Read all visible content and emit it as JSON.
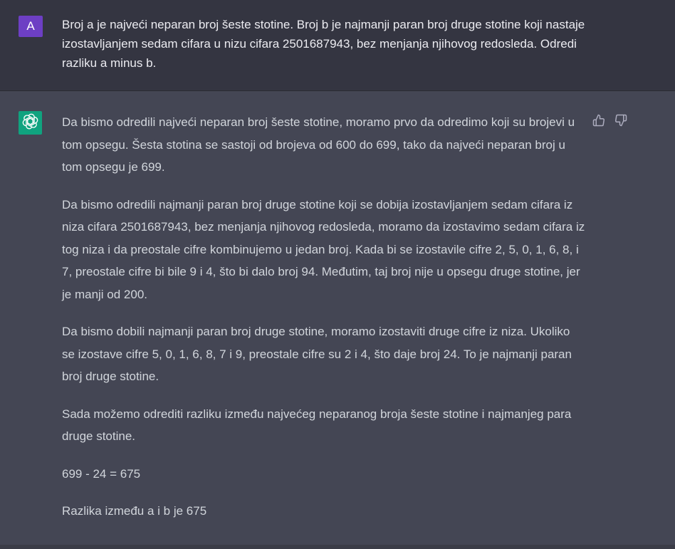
{
  "user": {
    "avatar_letter": "A",
    "avatar_color": "#6d3fc4",
    "message": "Broj a je najveći neparan broj šeste stotine. Broj b je najmanji paran broj druge stotine koji nastaje izostavljanjem sedam cifara u nizu cifara 2501687943, bez menjanja njihovog redosleda. Odredi razliku a minus b."
  },
  "assistant": {
    "avatar_icon": "openai-logo-icon",
    "avatar_color": "#10a37f",
    "feedback": {
      "like_icon": "thumbs-up-icon",
      "dislike_icon": "thumbs-down-icon"
    },
    "paragraphs": [
      "Da bismo odredili najveći neparan broj šeste stotine, moramo prvo da odredimo koji su brojevi u tom opsegu. Šesta stotina se sastoji od brojeva od 600 do 699, tako da najveći neparan broj u tom opsegu je 699.",
      "Da bismo odredili najmanji paran broj druge stotine koji se dobija izostavljanjem sedam cifara iz niza cifara 2501687943, bez menjanja njihovog redosleda, moramo da izostavimo sedam cifara iz tog niza i da preostale cifre kombinujemo u jedan broj. Kada bi se izostavile cifre 2, 5, 0, 1, 6, 8, i 7, preostale cifre bi bile 9 i 4, što bi dalo broj 94. Međutim, taj broj nije u opsegu druge stotine, jer je manji od 200.",
      "Da bismo dobili najmanji paran broj druge stotine, moramo izostaviti druge cifre iz niza. Ukoliko se izostave cifre 5, 0, 1, 6, 8, 7 i 9, preostale cifre su 2 i 4, što daje broj 24. To je najmanji paran broj druge stotine.",
      "Sada možemo odrediti razliku između najvećeg neparanog broja šeste stotine i najmanjeg para druge stotine.",
      "699 - 24 = 675",
      "Razlika između a i b je 675"
    ]
  }
}
